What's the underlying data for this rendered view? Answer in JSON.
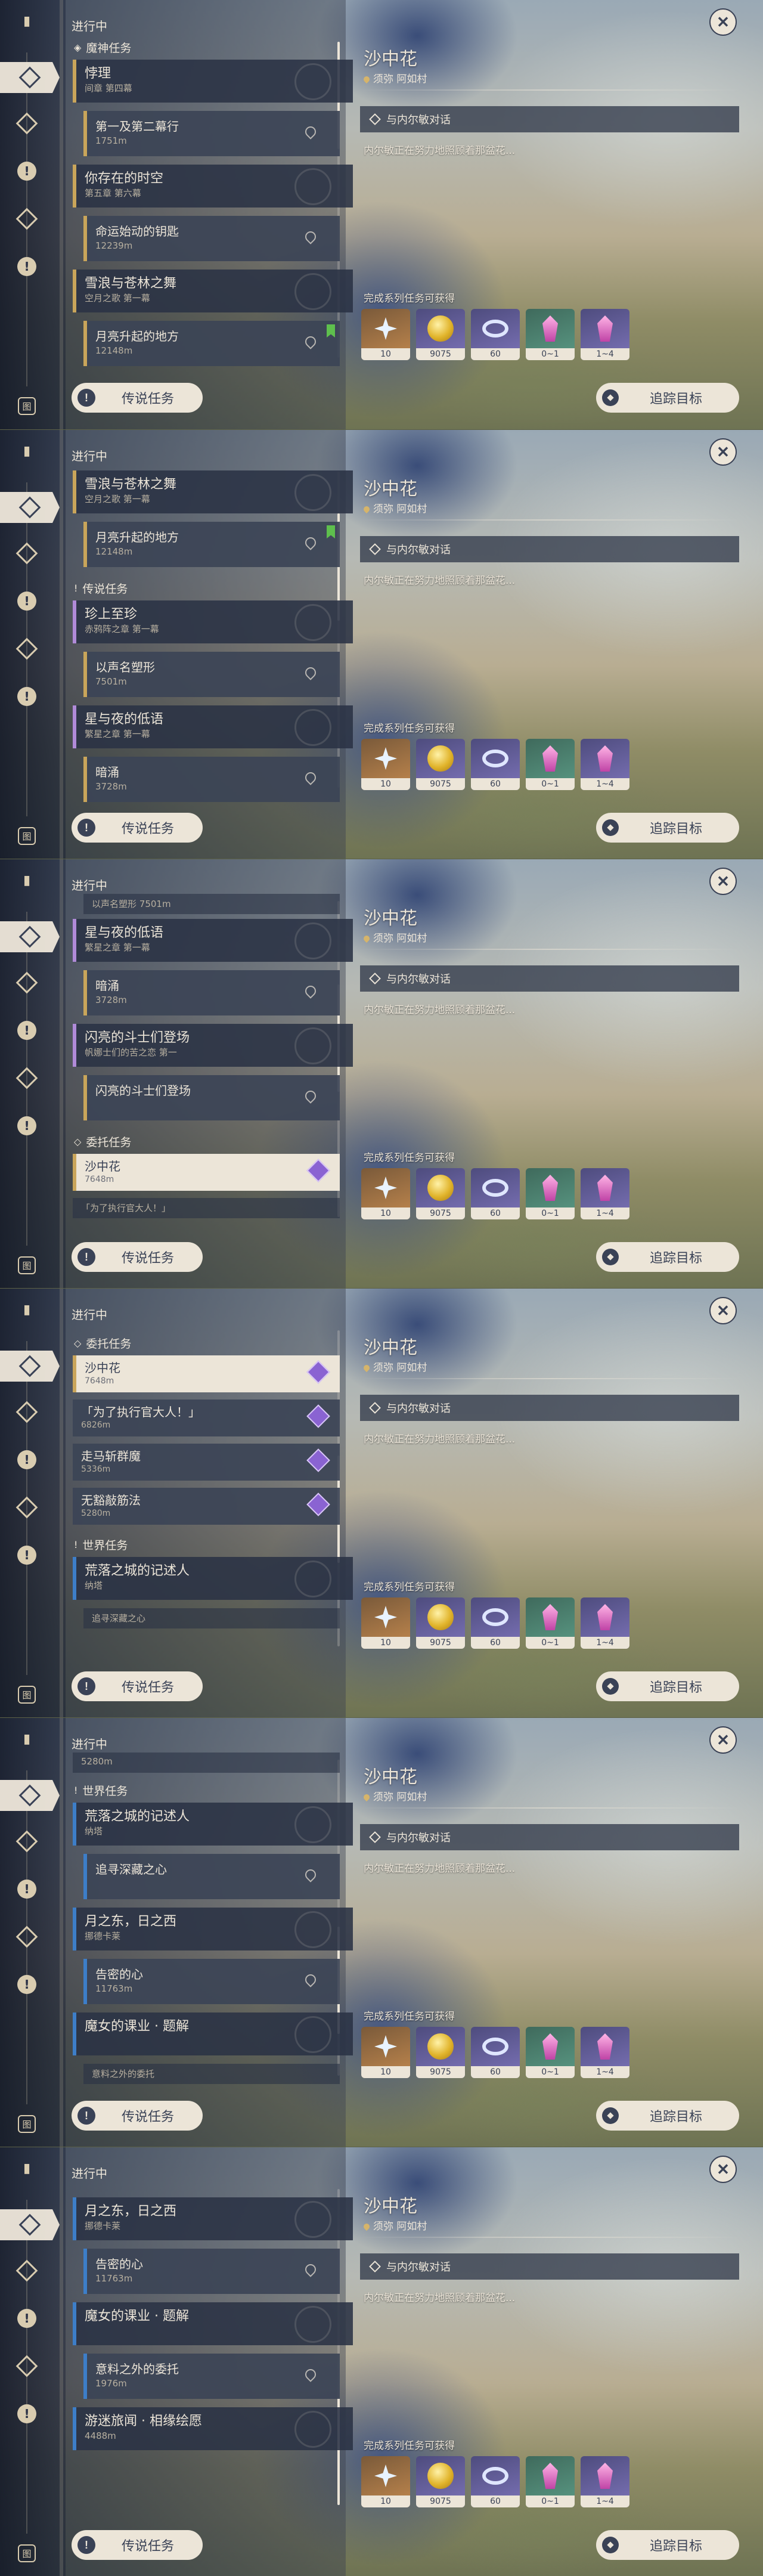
{
  "header": {
    "in_progress": "进行中"
  },
  "sections": {
    "archon": "魔神任务",
    "legend": "传说任务",
    "commission": "委托任务",
    "world": "世界任务"
  },
  "quests": {
    "jiaoli": {
      "title": "悖理",
      "sub": "间章 第四幕"
    },
    "first_dream": {
      "title": "第一及第二幕行",
      "dist": "1751m"
    },
    "your_time": {
      "title": "你存在的时空",
      "sub": "第五章 第六幕"
    },
    "key": {
      "title": "命运始动的钥匙",
      "dist": "12239m"
    },
    "snow": {
      "title": "雪浪与苍林之舞",
      "sub": "空月之歌 第一幕"
    },
    "moon_rise": {
      "title": "月亮升起的地方",
      "dist": "12148m"
    },
    "treasure": {
      "title": "珍上至珍",
      "sub": "赤鸦阵之章 第一幕"
    },
    "name_shape": {
      "title": "以声名塑形",
      "dist": "7501m"
    },
    "stars": {
      "title": "星与夜的低语",
      "sub": "繁星之章 第一幕"
    },
    "echo": {
      "title": "暗涌",
      "dist": "3728m"
    },
    "fighters": {
      "title": "闪亮的斗士们登场",
      "sub": "帆娜士们的苦之恋 第一"
    },
    "fighters_step": {
      "title": "闪亮的斗士们登场"
    },
    "sand": {
      "title": "沙中花",
      "dist": "7648m"
    },
    "officer": {
      "title": "「为了执行官大人！」",
      "dist": "6826m"
    },
    "horse": {
      "title": "走马斩群魔",
      "dist": "5336m"
    },
    "noblade": {
      "title": "无豁敲筋法",
      "dist": "5280m"
    },
    "ruins": {
      "title": "荒落之城的记述人",
      "sub": "纳塔"
    },
    "deep": {
      "title": "追寻深藏之心"
    },
    "moon_east": {
      "title": "月之东，日之西",
      "sub": "挪德卡莱"
    },
    "secret": {
      "title": "告密的心",
      "dist": "11763m"
    },
    "witch": {
      "title": "魔女的课业 · 题解"
    },
    "unexpected": {
      "title": "意料之外的委托",
      "dist": "1976m"
    },
    "travel": {
      "title": "游迷旅闻 · 相缘绘愿",
      "dist": "4488m"
    }
  },
  "partials": {
    "p_name": "以声名塑形",
    "p_name_dist": "7501m",
    "p_officer": "「为了执行官大人！」",
    "p_top_blank": "",
    "p_deep": "追寻深藏之心",
    "p_unexpected": "意料之外的委托",
    "p_5280": "5280m",
    "p_echo_dist": "3728m"
  },
  "detail": {
    "title": "沙中花",
    "location": "须弥 阿如村",
    "objective": "与内尔敏对话",
    "description": "内尔敏正在努力地照顾着那盆花...",
    "rewards_label": "完成系列任务可获得",
    "rewards": [
      {
        "icon": "primogem-icon",
        "count": "10"
      },
      {
        "icon": "mora-icon",
        "count": "9075"
      },
      {
        "icon": "adventure-exp-icon",
        "count": "60"
      },
      {
        "icon": "crystal-small-icon",
        "count": "0~1"
      },
      {
        "icon": "crystal-large-icon",
        "count": "1~4"
      }
    ]
  },
  "buttons": {
    "legend_quest": "传说任务",
    "track": "追踪目标",
    "close": "✕",
    "exclaim": "!"
  },
  "rail": {
    "bottom_icon": "图"
  }
}
